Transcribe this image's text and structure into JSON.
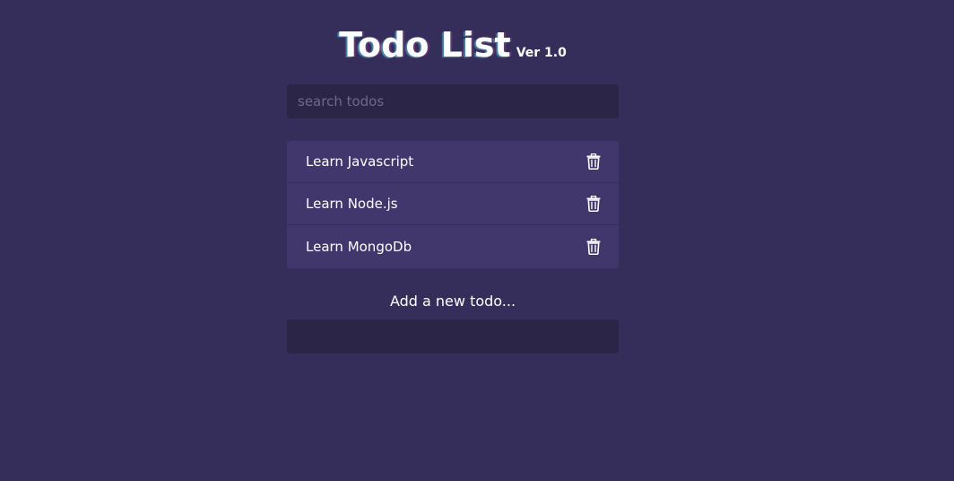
{
  "header": {
    "title": "Todo List",
    "version": "Ver 1.0"
  },
  "search": {
    "placeholder": "search todos",
    "value": ""
  },
  "todos": [
    {
      "text": "Learn Javascript",
      "icon": "trash-icon"
    },
    {
      "text": "Learn Node.js",
      "icon": "trash-icon"
    },
    {
      "text": "Learn MongoDb",
      "icon": "trash-icon"
    }
  ],
  "add_form": {
    "label": "Add a new todo...",
    "value": ""
  },
  "colors": {
    "background": "#352e5b",
    "input_background": "#2b2548",
    "list_item_background": "#42376d",
    "text": "#ffffff",
    "placeholder": "#6e6a88"
  }
}
